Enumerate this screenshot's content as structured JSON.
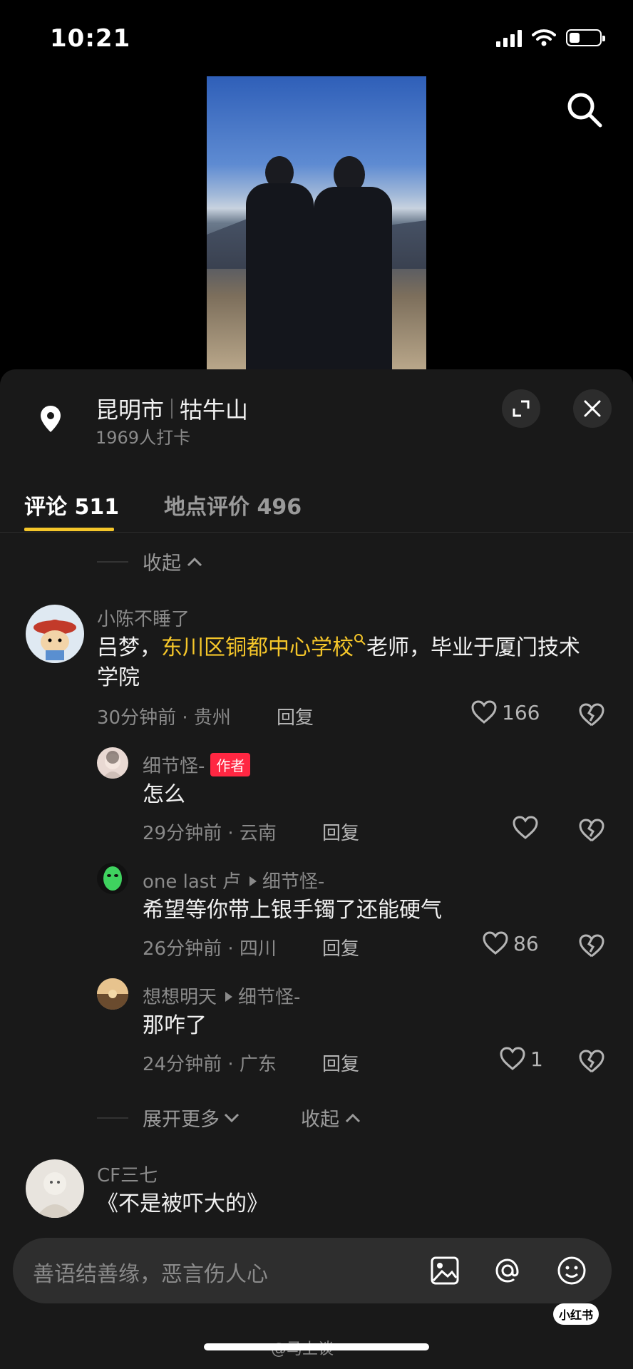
{
  "status": {
    "time": "10:21"
  },
  "location": {
    "city": "昆明市",
    "place": "牯牛山",
    "checkins": "1969人打卡"
  },
  "tabs": {
    "comments": "评论 511",
    "reviews": "地点评价 496"
  },
  "collapse_top": "收起",
  "comments": [
    {
      "user": "小陈不睡了",
      "text_pre": "吕梦，",
      "text_highlight": "东川区铜都中心学校",
      "text_post": "老师，毕业于厦门技术学院",
      "meta": "30分钟前 · 贵州",
      "reply": "回复",
      "likes": "166"
    }
  ],
  "replies": [
    {
      "user": "细节怪-",
      "badge": "作者",
      "text": "怎么",
      "meta": "29分钟前 · 云南",
      "reply": "回复",
      "likes": ""
    },
    {
      "user": "one last 卢",
      "to": "细节怪-",
      "text": "希望等你带上银手镯了还能硬气",
      "meta": "26分钟前 · 四川",
      "reply": "回复",
      "likes": "86"
    },
    {
      "user": "想想明天",
      "to": "细节怪-",
      "text": "那咋了",
      "meta": "24分钟前 · 广东",
      "reply": "回复",
      "likes": "1"
    }
  ],
  "expand_more": "展开更多",
  "collapse_bottom": "收起",
  "next_comment": {
    "user": "CF三七",
    "text": "《不是被吓大的》"
  },
  "input": {
    "placeholder": "善语结善缘，恶言伤人心"
  },
  "watermark": {
    "badge": "小红书",
    "weibo": "@马上谈"
  },
  "colors": {
    "highlight": "#f5c62a",
    "author_badge": "#ff2742",
    "sheet_bg": "#191919"
  }
}
